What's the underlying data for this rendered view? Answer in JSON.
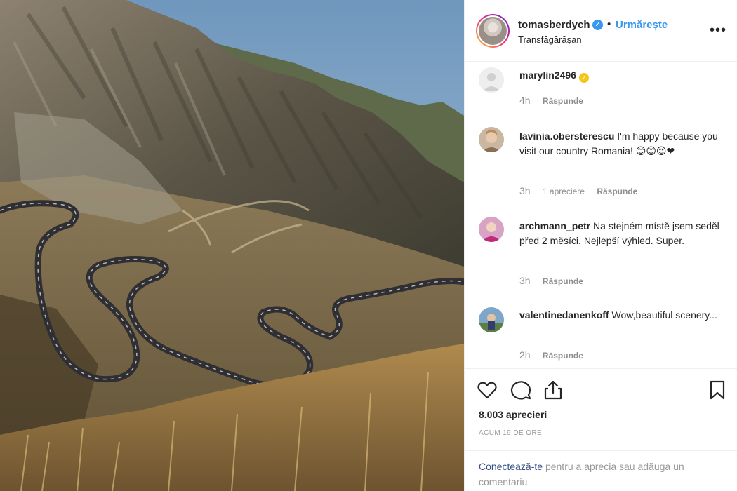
{
  "post": {
    "username": "tomasberdych",
    "verified_mark": "✓",
    "separator": "•",
    "follow_label": "Urmărește",
    "location": "Transfăgărășan",
    "more_label": "•••"
  },
  "comments": [
    {
      "user": "marylin2496",
      "text": "",
      "time": "4h",
      "likes": "",
      "reply": "Răspunde",
      "badge": "✓"
    },
    {
      "user": "lavinia.obersterescu",
      "text": " I'm happy because you visit our country Romania! 😊😊😍❤",
      "time": "3h",
      "likes": "1 apreciere",
      "reply": "Răspunde"
    },
    {
      "user": "archmann_petr",
      "text": " Na stejném místě jsem seděl před 2 měsíci. Nejlepší výhled. Super.",
      "time": "3h",
      "likes": "",
      "reply": "Răspunde"
    },
    {
      "user": "valentinedanenkoff",
      "text": " Wow,beautiful scenery...",
      "time": "2h",
      "likes": "",
      "reply": "Răspunde"
    }
  ],
  "actions": {
    "icons": [
      "heart-icon",
      "comment-icon",
      "share-icon",
      "bookmark-icon"
    ],
    "likes_count": "8.003 aprecieri",
    "posted_ago": "ACUM 19 DE ORE"
  },
  "login": {
    "link": "Conectează-te",
    "rest": " pentru a aprecia sau adăuga un comentariu"
  },
  "colors": {
    "accent": "#3897f0",
    "text": "#262626",
    "muted": "#8e8e8e",
    "border": "#efefef"
  }
}
